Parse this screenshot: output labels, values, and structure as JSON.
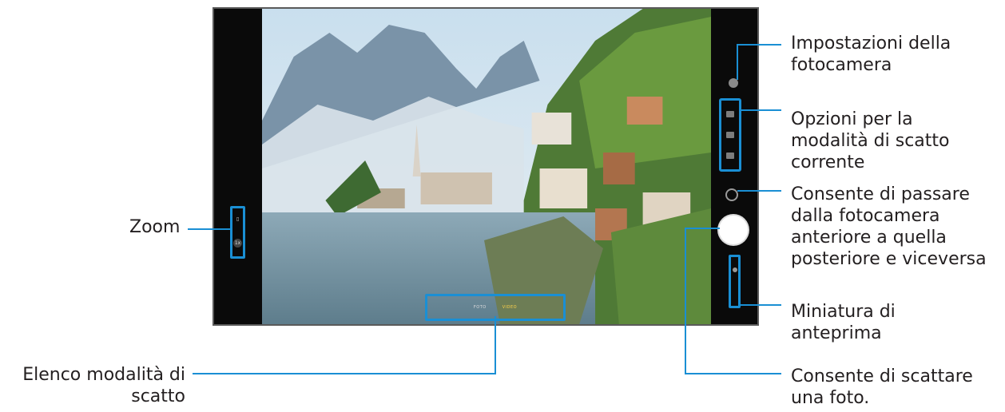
{
  "camera": {
    "zoom_options": [
      "▯",
      "1x"
    ],
    "modes": [
      "FOTO",
      "VIDEO"
    ]
  },
  "labels": {
    "settings": "Impostazioni della\nfotocamera",
    "options": "Opzioni per la\nmodalità di scatto\ncorrente",
    "switch_camera": "Consente di passare\ndalla fotocamera\nanteriore a quella\nposteriore e viceversa",
    "preview_thumbnail": "Miniatura di\nanteprima",
    "take_photo": "Consente di scattare\nuna foto.",
    "zoom": "Zoom",
    "mode_list": "Elenco modalità di\nscatto"
  },
  "colors": {
    "callout": "#1a8fd4",
    "frame": "#000000"
  }
}
